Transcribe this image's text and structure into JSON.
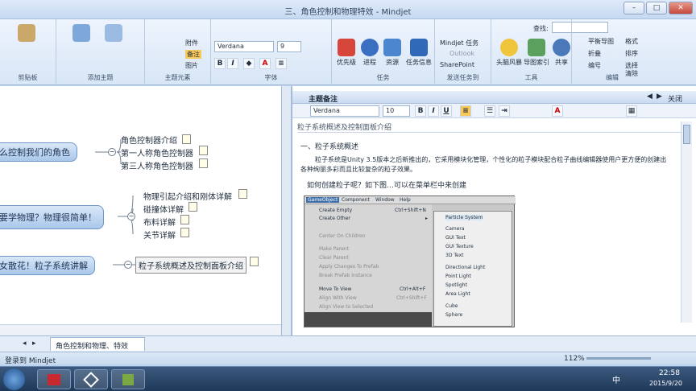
{
  "window": {
    "title": "三、角色控制和物理特效 - Mindjet",
    "minimize": "–",
    "maximize": "□",
    "close": "✕"
  },
  "ribbon": {
    "search_label": "查找:",
    "groups": {
      "clipboard": "剪贴板",
      "add_topic": "添加主题",
      "topic_elements": "主题元素",
      "font": "字体",
      "tasks": "任务",
      "send_tasks": "发送任务到",
      "tools": "工具",
      "edit": "编辑"
    },
    "topic_elements_items": [
      "附件",
      "备注",
      "图片"
    ],
    "font_name": "Verdana",
    "font_size": "9",
    "task_buttons": [
      "优先级",
      "进程",
      "资源",
      "任务信息"
    ],
    "send_items": [
      "Mindjet 任务",
      "Outlook",
      "SharePoint"
    ],
    "tool_buttons": [
      "头脑风暴",
      "导图索引",
      "共享"
    ],
    "edit_items": [
      "平衡导图",
      "格式",
      "折叠",
      "排序",
      "选择",
      "清除",
      "编号"
    ]
  },
  "map": {
    "main_topics": [
      {
        "label": "么控制我们的角色",
        "subs": [
          "角色控制器介绍",
          "第一人称角色控制器",
          "第三人称角色控制器"
        ]
      },
      {
        "label": "要学物理？物理很简单！",
        "subs": [
          "物理引起介绍和刚体详解",
          "碰撞体详解",
          "布料详解",
          "关节详解"
        ]
      },
      {
        "label": "女散花！粒子系统讲解",
        "subs": [
          "粒子系统概述及控制面板介绍"
        ]
      }
    ],
    "collapse_glyph": "−"
  },
  "notes": {
    "header": "主题备注",
    "close_label": "关闭",
    "font_name": "Verdana",
    "font_size": "10",
    "topic_title": "粒子系统概述及控制面板介绍",
    "section_heading": "一、粒子系统概述",
    "paragraph": "粒子系统是Unity 3.5版本之后新推出的，它采用模块化管理，个性化的粒子模块配合粒子曲线编辑器使用户更方便的创建出各种绚丽多彩而且比较复杂的粒子效果。",
    "question": "如何创建粒子呢？如下图…可以在菜单栏中来创建",
    "menu_bar": [
      "GameObject",
      "Component",
      "Window",
      "Help"
    ],
    "menu_items": [
      {
        "label": "Create Empty",
        "shortcut": "Ctrl+Shift+N"
      },
      {
        "label": "Create Other",
        "shortcut": "▸"
      },
      {
        "label": "Center On Children",
        "shortcut": ""
      },
      {
        "label": "Make Parent",
        "shortcut": ""
      },
      {
        "label": "Clear Parent",
        "shortcut": ""
      },
      {
        "label": "Apply Changes To Prefab",
        "shortcut": ""
      },
      {
        "label": "Break Prefab Instance",
        "shortcut": ""
      },
      {
        "label": "Move To View",
        "shortcut": "Ctrl+Alt+F"
      },
      {
        "label": "Align With View",
        "shortcut": "Ctrl+Shift+F"
      },
      {
        "label": "Align View to Selected",
        "shortcut": ""
      }
    ],
    "submenu_items": [
      "Particle System",
      "Camera",
      "GUI Text",
      "GUI Texture",
      "3D Text",
      "Directional Light",
      "Point Light",
      "Spotlight",
      "Area Light",
      "Cube",
      "Sphere"
    ]
  },
  "tabs": {
    "active": "角色控制和物理、特效"
  },
  "status": {
    "login": "登录到 Mindjet",
    "zoom": "112%"
  },
  "taskbar": {
    "time": "22:58",
    "date": "2015/9/20",
    "ime": "中"
  },
  "colors": {
    "ribbon": "#dde9f7",
    "topic": "#bad4f1",
    "taskbar": "#2d4a70"
  }
}
